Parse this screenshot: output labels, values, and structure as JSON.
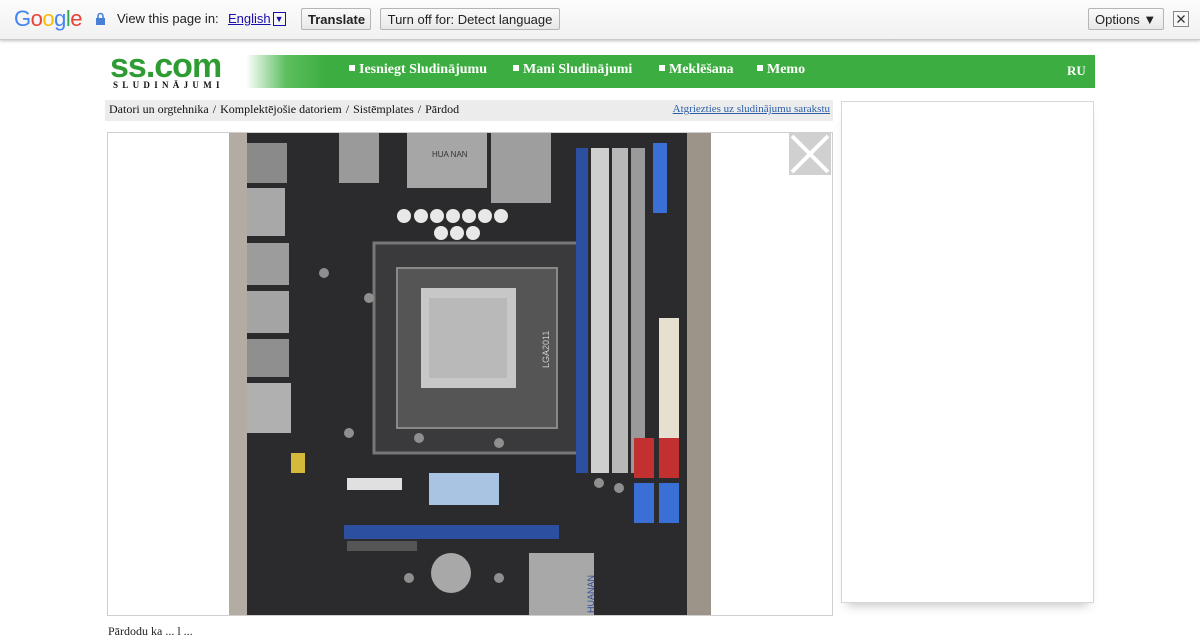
{
  "translate_bar": {
    "logo": "Google",
    "view_text": "View this page in:",
    "language": "English",
    "language_dropdown": "▼",
    "translate_button": "Translate",
    "turnoff_button": "Turn off for: Detect language",
    "options_button": "Options ▼",
    "close_icon": "close-icon"
  },
  "site": {
    "logo_main": "ss.com",
    "logo_sub": "SLUDINĀJUMI",
    "nav": [
      {
        "label": "Iesniegt Sludinājumu"
      },
      {
        "label": "Mani Sludinājumi"
      },
      {
        "label": "Meklēšana"
      },
      {
        "label": "Memo"
      }
    ],
    "lang_switch": "RU",
    "brand_color": "#3cad40"
  },
  "breadcrumb": {
    "items": [
      "Datori un orgtehnika",
      "Komplektējošie datoriem",
      "Sistēmplates",
      "Pārdod"
    ],
    "separator": "/",
    "back_link": "Atgriezties uz sludinājumu sarakstu"
  },
  "photo": {
    "subject": "motherboard-photo",
    "chip_label_1": "HUANAN",
    "socket_label": "LGA2011",
    "heatsink_label": "HUANAN"
  },
  "bottom_text": "Pārdodu ka ... l ..."
}
